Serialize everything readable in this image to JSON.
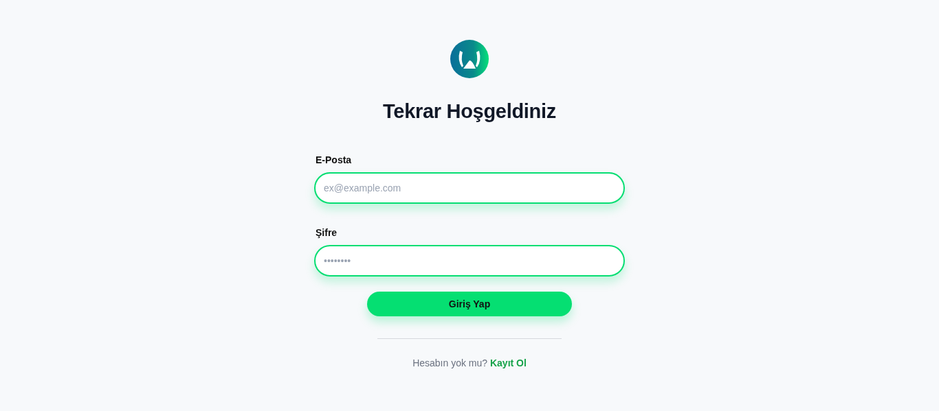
{
  "title": "Tekrar Hoşgeldiniz",
  "fields": [
    {
      "label": "E-Posta",
      "placeholder": "ex@example.com"
    },
    {
      "label": "Şifre",
      "placeholder": "••••••••"
    }
  ],
  "submit_button": "Giriş Yap",
  "footer": {
    "text": "Hesabın yok mu?",
    "link": "Kayıt Ol"
  }
}
